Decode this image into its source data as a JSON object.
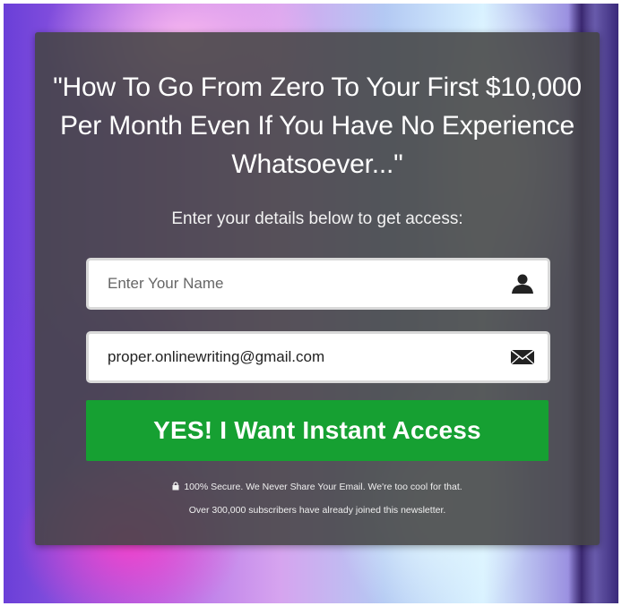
{
  "headline": "\"How To Go From Zero To Your First $10,000 Per Month Even If You Have No Experience Whatsoever...\"",
  "subheadline": "Enter your details below to get access:",
  "form": {
    "name_placeholder": "Enter Your Name",
    "name_value": "",
    "name_icon": "user-icon",
    "email_value": "proper.onlinewriting@gmail.com",
    "email_icon": "envelope-icon",
    "submit_label": "YES! I Want Instant Access"
  },
  "privacy_note": "100% Secure. We Never Share Your Email. We're too cool for that.",
  "privacy_icon": "lock-icon",
  "subscribers_note": "Over 300,000 subscribers have already joined this newsletter.",
  "colors": {
    "panel": "#444444",
    "button": "#16a032",
    "text": "#ffffff"
  }
}
